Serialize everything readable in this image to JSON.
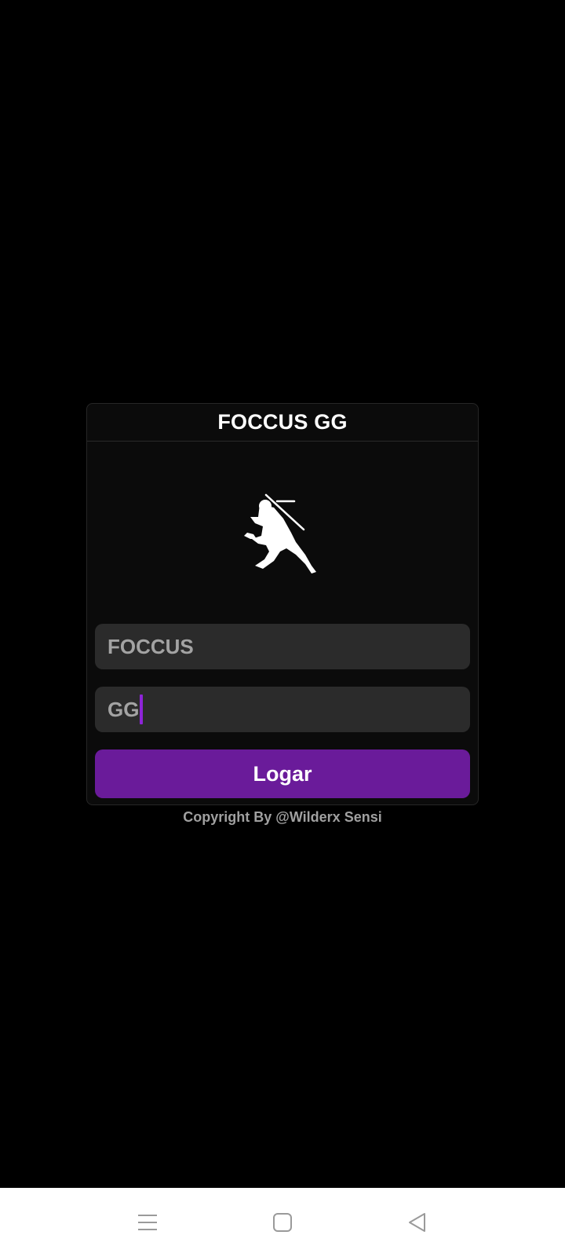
{
  "app": {
    "title": "FOCCUS GG",
    "logo_icon": "ninja-silhouette-icon"
  },
  "login": {
    "username_value": "FOCCUS",
    "password_value": "GG",
    "submit_label": "Logar"
  },
  "footer": {
    "copyright": "Copyright By @Wilderx Sensi"
  },
  "navigation": {
    "menu_icon": "menu-icon",
    "home_icon": "home-square-icon",
    "back_icon": "back-triangle-icon"
  },
  "colors": {
    "background": "#000000",
    "card": "#0b0b0b",
    "input": "#2b2b2b",
    "accent": "#6a1b9a",
    "caret": "#8e24d8",
    "nav_bar": "#ffffff"
  }
}
